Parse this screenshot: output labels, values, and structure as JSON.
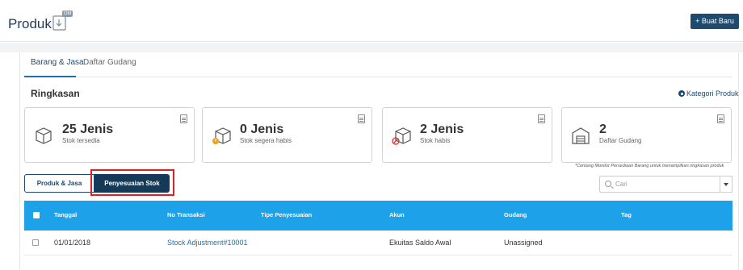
{
  "header": {
    "title": "Produk",
    "title_icon": "import-icon",
    "badge": "Old",
    "new_button_label": "+ Buat Baru"
  },
  "tabs": [
    {
      "label": "Barang & Jasa",
      "active": true
    },
    {
      "label": "Daftar Gudang",
      "active": false
    }
  ],
  "summary": {
    "title": "Ringkasan",
    "kategori_link": "Kategori Produk",
    "boxes": [
      {
        "value": "25 Jenis",
        "label": "Stok tersedia",
        "icon": "box-icon"
      },
      {
        "value": "0 Jenis",
        "label": "Stok segera habis",
        "icon": "box-warning-icon"
      },
      {
        "value": "2 Jenis",
        "label": "Stok habis",
        "icon": "box-empty-icon"
      },
      {
        "value": "2",
        "label": "Daftar Gudang",
        "icon": "warehouse-icon"
      }
    ],
    "hint": "*Centang Monitor Persediaan Barang untuk menampilkan ringkasan produk"
  },
  "toggle": {
    "produk_label": "Produk & Jasa",
    "penyesuaian_label": "Penyesuaian Stok",
    "active": "Penyesuaian Stok"
  },
  "search": {
    "placeholder": "Cari",
    "value": ""
  },
  "table": {
    "columns": [
      "Tanggal",
      "No Transaksi",
      "Tipe Penyesuaian",
      "Akun",
      "Gudang",
      "Tag"
    ],
    "rows": [
      {
        "tanggal": "01/01/2018",
        "no_transaksi": "Stock Adjustment#10001",
        "tipe": "",
        "akun": "Ekuitas Saldo Awal",
        "gudang": "Unassigned",
        "tag": ""
      }
    ]
  },
  "colors": {
    "accent": "#1d4a6f",
    "table_header": "#1da1e8",
    "highlight": "#e02020",
    "link": "#1d6fb0"
  }
}
